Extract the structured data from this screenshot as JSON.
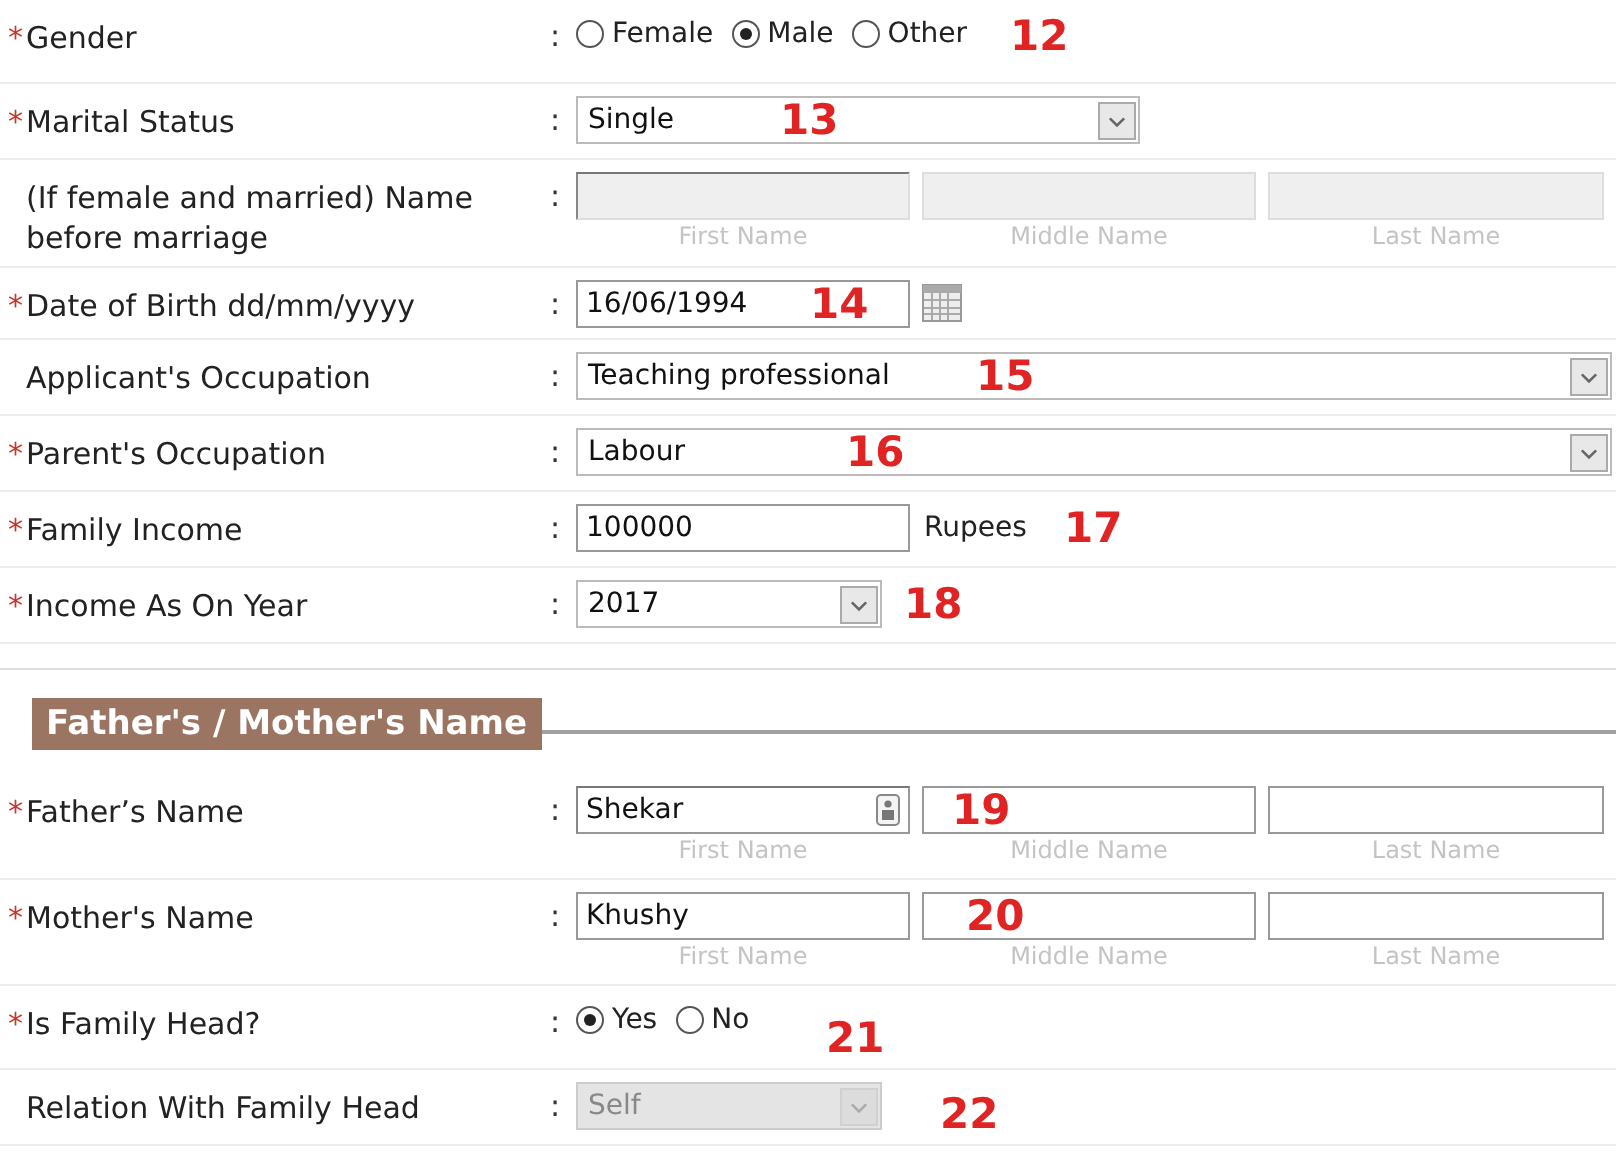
{
  "form": {
    "rows": [
      {
        "kind": "radio",
        "marker": "*",
        "label": "Gender",
        "colon": ":",
        "options": [
          {
            "label": "Female",
            "selected": false
          },
          {
            "label": "Male",
            "selected": true
          },
          {
            "label": "Other",
            "selected": false
          }
        ],
        "annotation": "12"
      },
      {
        "kind": "select",
        "marker": "*",
        "label": "Marital Status",
        "colon": ":",
        "value": "Single",
        "disabled": false,
        "annotation": "13"
      },
      {
        "kind": "names",
        "label": "(If female and married) Name before marriage",
        "colon": ":",
        "disabled": true,
        "fields": [
          {
            "hint": "First Name"
          },
          {
            "hint": "Middle Name"
          },
          {
            "hint": "Last Name"
          }
        ]
      },
      {
        "kind": "date",
        "marker": "*",
        "label": "Date of Birth dd/mm/yyyy",
        "colon": ":",
        "value": "16/06/1994",
        "annotation": "14"
      },
      {
        "kind": "select",
        "label": "Applicant's Occupation",
        "colon": ":",
        "value": "Teaching professional",
        "disabled": false,
        "annotation": "15"
      },
      {
        "kind": "select",
        "marker": "*",
        "label": "Parent's Occupation",
        "colon": ":",
        "value": "Labour",
        "disabled": false,
        "annotation": "16"
      },
      {
        "kind": "text",
        "marker": "*",
        "label": "Family Income",
        "colon": ":",
        "value": "100000",
        "unit": "Rupees",
        "annotation": "17"
      },
      {
        "kind": "select",
        "marker": "*",
        "label": "Income As On Year",
        "colon": ":",
        "value": "2017",
        "disabled": false,
        "annotation": "18"
      }
    ]
  },
  "family": {
    "title": "Father's / Mother's Name",
    "rows": [
      {
        "kind": "names",
        "marker": "*",
        "label": "Father’s Name",
        "colon": ":",
        "disabled": false,
        "fields": [
          {
            "value": "Shekar",
            "hint": "First Name",
            "has_icon": true
          },
          {
            "hint": "Middle Name"
          },
          {
            "hint": "Last Name"
          }
        ],
        "annotation": "19"
      },
      {
        "kind": "names",
        "marker": "*",
        "label": "Mother's Name",
        "colon": ":",
        "disabled": false,
        "fields": [
          {
            "value": "Khushy",
            "hint": "First Name"
          },
          {
            "hint": "Middle Name"
          },
          {
            "hint": "Last Name"
          }
        ],
        "annotation": "20"
      },
      {
        "kind": "radio",
        "marker": "*",
        "label": "Is Family Head?",
        "colon": ":",
        "options": [
          {
            "label": "Yes",
            "selected": true
          },
          {
            "label": "No",
            "selected": false
          }
        ],
        "annotation": "21"
      },
      {
        "kind": "select",
        "label": "Relation With Family Head",
        "colon": ":",
        "value": "Self",
        "disabled": true,
        "annotation": "22"
      }
    ]
  }
}
